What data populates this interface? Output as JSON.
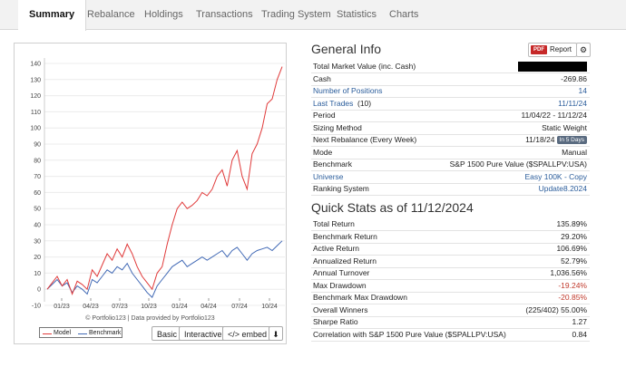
{
  "tabs": [
    "Summary",
    "Rebalance",
    "Holdings",
    "Transactions",
    "Trading System",
    "Statistics",
    "Charts"
  ],
  "chart": {
    "credit": "© Portfolio123 | Data provided by Portfolio123",
    "legend": [
      "Model",
      "Benchmark"
    ],
    "buttons": {
      "basic": "Basic",
      "interactive": "Interactive",
      "embed": "</> embed"
    }
  },
  "chart_data": {
    "type": "line",
    "x_tick_labels": [
      "01/23",
      "04/23",
      "07/23",
      "10/23",
      "01/24",
      "04/24",
      "07/24",
      "10/24"
    ],
    "y_tick_labels": [
      "-10",
      "0",
      "10",
      "20",
      "30",
      "40",
      "50",
      "60",
      "70",
      "80",
      "90",
      "100",
      "110",
      "120",
      "130",
      "140"
    ],
    "ylim": [
      -10,
      140
    ],
    "series": [
      {
        "name": "Model",
        "color": "#e03a3a",
        "values": [
          0,
          4,
          8,
          2,
          6,
          -3,
          5,
          3,
          0,
          12,
          8,
          15,
          22,
          18,
          25,
          20,
          28,
          22,
          14,
          8,
          4,
          0,
          10,
          14,
          28,
          40,
          50,
          54,
          50,
          52,
          55,
          60,
          58,
          62,
          70,
          74,
          64,
          80,
          86,
          70,
          62,
          84,
          90,
          100,
          115,
          118,
          130,
          138
        ]
      },
      {
        "name": "Benchmark",
        "color": "#4169b5",
        "values": [
          0,
          3,
          6,
          2,
          4,
          -2,
          2,
          0,
          -3,
          6,
          4,
          8,
          12,
          10,
          14,
          12,
          16,
          10,
          6,
          2,
          -2,
          -5,
          2,
          6,
          10,
          14,
          16,
          18,
          14,
          16,
          18,
          20,
          18,
          20,
          22,
          24,
          20,
          24,
          26,
          22,
          18,
          22,
          24,
          25,
          26,
          24,
          27,
          30
        ]
      }
    ]
  },
  "general": {
    "title": "General Info",
    "report_label": "Report",
    "pdf_label": "PDF",
    "rows": [
      {
        "label": "Total Market Value (inc. Cash)",
        "value": ""
      },
      {
        "label": "Cash",
        "value": "-269.86"
      },
      {
        "label": "Number of Positions",
        "value": "14"
      },
      {
        "label": "Last Trades",
        "label_extra": " (10)",
        "value": "11/11/24"
      },
      {
        "label": "Period",
        "value": "11/04/22 - 11/12/24"
      },
      {
        "label": "Sizing Method",
        "value": "Static Weight"
      },
      {
        "label": "Next Rebalance (Every Week)",
        "value": "11/18/24",
        "badge": "In 5 Days"
      },
      {
        "label": "Mode",
        "value": "Manual"
      },
      {
        "label": "Benchmark",
        "value": "S&P 1500 Pure Value ($SPALLPV:USA)"
      },
      {
        "label": "Universe",
        "value": "Easy 100K - Copy"
      },
      {
        "label": "Ranking System",
        "value": "Update8.2024"
      }
    ]
  },
  "quick": {
    "title": "Quick Stats as of 11/12/2024",
    "rows": [
      {
        "label": "Total Return",
        "value": "135.89%"
      },
      {
        "label": "Benchmark Return",
        "value": "29.20%"
      },
      {
        "label": "Active Return",
        "value": "106.69%"
      },
      {
        "label": "Annualized Return",
        "value": "52.79%"
      },
      {
        "label": "Annual Turnover",
        "value": "1,036.56%"
      },
      {
        "label": "Max Drawdown",
        "value": "-19.24%"
      },
      {
        "label": "Benchmark Max Drawdown",
        "value": "-20.85%"
      },
      {
        "label": "Overall Winners",
        "value": "(225/402) 55.00%"
      },
      {
        "label": "Sharpe Ratio",
        "value": "1.27"
      },
      {
        "label": "Correlation with S&P 1500 Pure Value ($SPALLPV:USA)",
        "value": "0.84"
      }
    ]
  }
}
